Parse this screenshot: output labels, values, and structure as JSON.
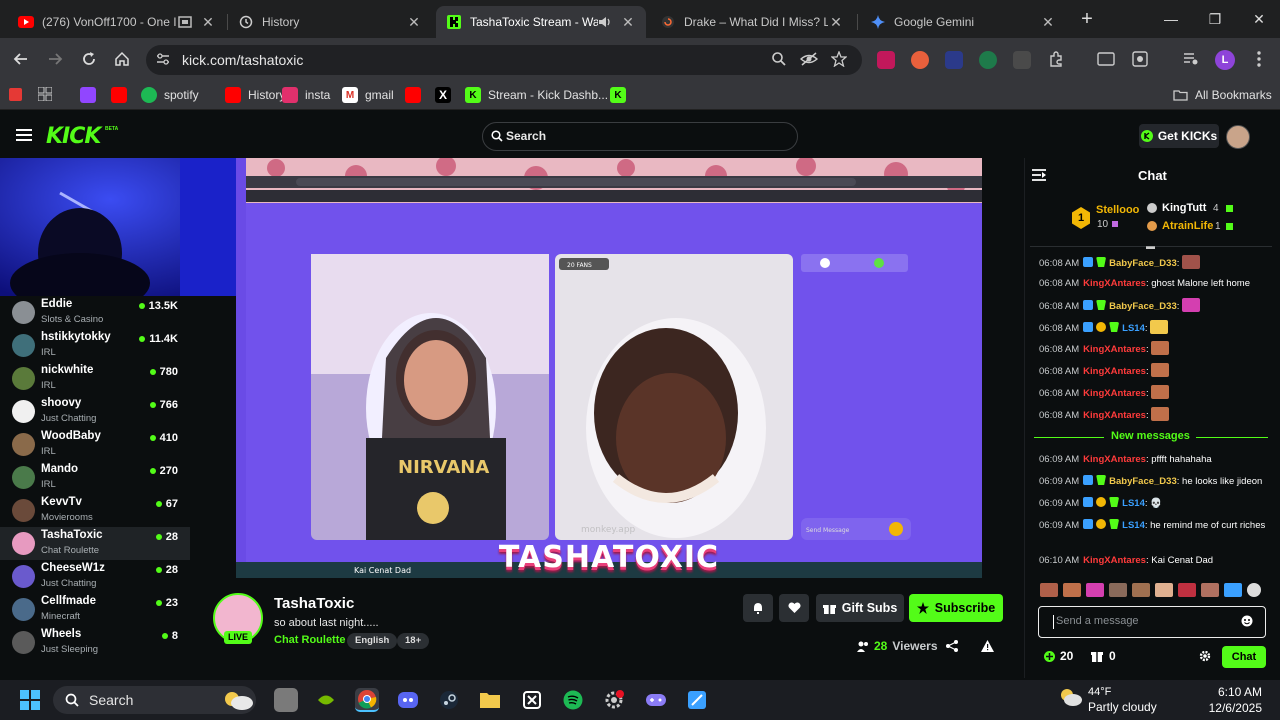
{
  "browser": {
    "tabs": [
      {
        "title": "(276) VonOff1700 - One I",
        "icon": "youtube-icon",
        "active": false
      },
      {
        "title": "History",
        "icon": "history-icon",
        "active": false
      },
      {
        "title": "TashaToxic Stream - Watc",
        "icon": "kick-icon",
        "active": true
      },
      {
        "title": "Drake – What Did I Miss? Lyr",
        "icon": "genius-icon",
        "active": false
      },
      {
        "title": "Google Gemini",
        "icon": "gemini-icon",
        "active": false
      }
    ],
    "url": "kick.com/tashatoxic",
    "profile_initial": "L",
    "bookmarks": [
      {
        "label": "",
        "icon": "twitch-icon"
      },
      {
        "label": "",
        "icon": "youtube-icon"
      },
      {
        "label": "spotify",
        "icon": "spotify-icon"
      },
      {
        "label": "History",
        "icon": "youtube-icon"
      },
      {
        "label": "insta",
        "icon": "instagram-icon"
      },
      {
        "label": "gmail",
        "icon": "gmail-icon"
      },
      {
        "label": "",
        "icon": "youtube-icon"
      },
      {
        "label": "",
        "icon": "x-icon"
      },
      {
        "label": "Stream - Kick Dashb...",
        "icon": "kick-icon"
      },
      {
        "label": "",
        "icon": "kick-icon"
      }
    ],
    "all_bookmarks": "All Bookmarks"
  },
  "kick": {
    "logo": "KICK",
    "logo_badge": "BETA",
    "search_placeholder": "Search",
    "get_kicks": "Get KICKs"
  },
  "sidebar": {
    "channels": [
      {
        "name": "Eddie",
        "category": "Slots & Casino",
        "viewers": "13.5K",
        "color": "#8a8f94"
      },
      {
        "name": "hstikkytokky",
        "category": "IRL",
        "viewers": "11.4K",
        "color": "#3f6f7a"
      },
      {
        "name": "nickwhite",
        "category": "IRL",
        "viewers": "780",
        "color": "#5a7a3a"
      },
      {
        "name": "shoovy",
        "category": "Just Chatting",
        "viewers": "766",
        "color": "#f0f0f0"
      },
      {
        "name": "WoodBaby",
        "category": "IRL",
        "viewers": "410",
        "color": "#8a6a4a"
      },
      {
        "name": "Mando",
        "category": "IRL",
        "viewers": "270",
        "color": "#4a7a4a"
      },
      {
        "name": "KevvTv",
        "category": "Movierooms",
        "viewers": "67",
        "color": "#6a4a3a"
      },
      {
        "name": "TashaToxic",
        "category": "Chat Roulette",
        "viewers": "28",
        "color": "#e79ac0"
      },
      {
        "name": "CheeseW1z",
        "category": "Just Chatting",
        "viewers": "28",
        "color": "#6a5acd"
      },
      {
        "name": "Cellfmade",
        "category": "Minecraft",
        "viewers": "23",
        "color": "#4a6a8a"
      },
      {
        "name": "Wheels",
        "category": "Just Sleeping",
        "viewers": "8",
        "color": "#5a5a5a"
      }
    ]
  },
  "video": {
    "overlay_name": "TASHATOXIC",
    "inner_url": "monkey.app/home",
    "inner_message_placeholder": "Send Message",
    "inner_watermark": "monkey.app",
    "inner_taskbar_text": "Kai Cenat Dad",
    "inner_badge": "20 FANS"
  },
  "stream": {
    "streamer": "TashaToxic",
    "live_label": "LIVE",
    "title": "so about last night.....",
    "category": "Chat Roulette",
    "tags": [
      "English",
      "18+"
    ],
    "gift_subs": "Gift Subs",
    "subscribe": "Subscribe",
    "viewers": "28",
    "viewers_label": "Viewers"
  },
  "chat": {
    "title": "Chat",
    "leaderboard": [
      {
        "rank": "1",
        "name": "Stellooo",
        "value": "10"
      },
      {
        "rank": "",
        "name": "KingTutt",
        "value": "4"
      },
      {
        "rank": "",
        "name": "AtrainLife",
        "value": "1"
      }
    ],
    "messages": [
      {
        "time": "06:08 AM",
        "user": "BabyFace_D33",
        "color": "#f2c94c",
        "text": "",
        "emote": "#a0524a"
      },
      {
        "time": "06:08 AM",
        "user": "KingXAntares",
        "color": "#ff3b3b",
        "text": "ghost Malone left home",
        "emote": ""
      },
      {
        "time": "06:08 AM",
        "user": "BabyFace_D33",
        "color": "#f2c94c",
        "text": "",
        "emote": "#d43fb0"
      },
      {
        "time": "06:08 AM",
        "user": "LS14",
        "color": "#3aa0ff",
        "text": "",
        "emote": "#f2c94c"
      },
      {
        "time": "06:08 AM",
        "user": "KingXAntares",
        "color": "#ff3b3b",
        "text": "",
        "emote": "#c0704a"
      },
      {
        "time": "06:08 AM",
        "user": "KingXAntares",
        "color": "#ff3b3b",
        "text": "",
        "emote": "#c0704a"
      },
      {
        "time": "06:08 AM",
        "user": "KingXAntares",
        "color": "#ff3b3b",
        "text": "",
        "emote": "#c0704a"
      },
      {
        "time": "06:08 AM",
        "user": "KingXAntares",
        "color": "#ff3b3b",
        "text": "",
        "emote": "#c0704a"
      }
    ],
    "new_messages_label": "New messages",
    "new_messages": [
      {
        "time": "06:09 AM",
        "user": "KingXAntares",
        "color": "#ff3b3b",
        "text": "pffft hahahaha"
      },
      {
        "time": "06:09 AM",
        "user": "BabyFace_D33",
        "color": "#f2c94c",
        "text": "he looks like jideon"
      },
      {
        "time": "06:09 AM",
        "user": "LS14",
        "color": "#3aa0ff",
        "text": "💀"
      },
      {
        "time": "06:09 AM",
        "user": "LS14",
        "color": "#3aa0ff",
        "text": "he remind me of curt riches"
      },
      {
        "time": "06:10 AM",
        "user": "KingXAntares",
        "color": "#ff3b3b",
        "text": "Kai Cenat Dad"
      }
    ],
    "input_placeholder": "Send a message",
    "points": "20",
    "gifts": "0",
    "send_label": "Chat"
  },
  "taskbar": {
    "search": "Search",
    "weather_temp": "44°F",
    "weather_desc": "Partly cloudy",
    "time": "6:10 AM",
    "date": "12/6/2025"
  }
}
